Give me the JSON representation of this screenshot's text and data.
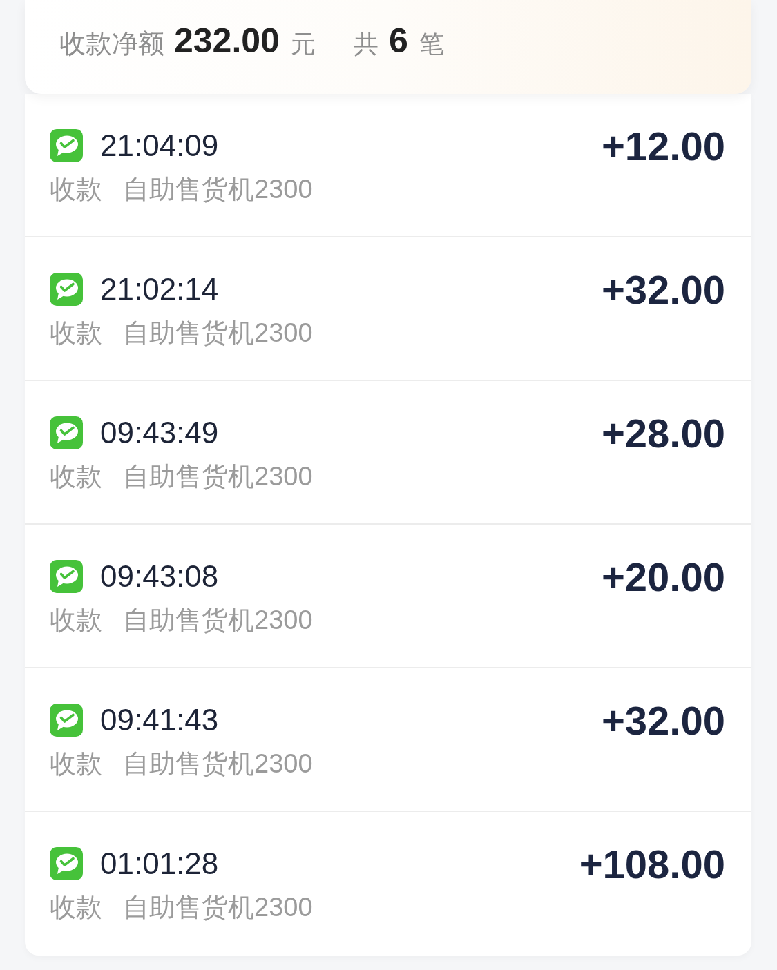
{
  "summary": {
    "net_label": "收款净额",
    "net_amount": "232.00",
    "currency": "元",
    "count_prefix": "共",
    "count": "6",
    "count_suffix": "笔"
  },
  "transactions": [
    {
      "time": "21:04:09",
      "type": "收款",
      "merchant": "自助售货机2300",
      "amount": "+12.00"
    },
    {
      "time": "21:02:14",
      "type": "收款",
      "merchant": "自助售货机2300",
      "amount": "+32.00"
    },
    {
      "time": "09:43:49",
      "type": "收款",
      "merchant": "自助售货机2300",
      "amount": "+28.00"
    },
    {
      "time": "09:43:08",
      "type": "收款",
      "merchant": "自助售货机2300",
      "amount": "+20.00"
    },
    {
      "time": "09:41:43",
      "type": "收款",
      "merchant": "自助售货机2300",
      "amount": "+32.00"
    },
    {
      "time": "01:01:28",
      "type": "收款",
      "merchant": "自助售货机2300",
      "amount": "+108.00"
    }
  ]
}
